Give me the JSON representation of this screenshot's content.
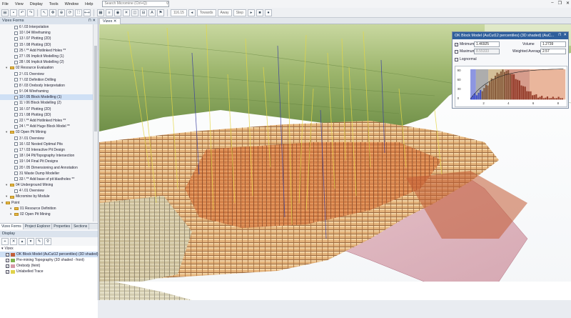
{
  "menu": {
    "items": [
      "File",
      "View",
      "Display",
      "Tools",
      "Window",
      "Help"
    ],
    "search_placeholder": "Search Micromine (Ctrl+Q)"
  },
  "toolbar": {
    "zoom_value": "116.15",
    "towards": "Towards",
    "away": "Away",
    "step": "Step"
  },
  "left_pane": {
    "title": "Vizex Forms",
    "tree": [
      {
        "label": "6 \\ 03 Interpolation",
        "indent": 3,
        "kind": "form"
      },
      {
        "label": "10 \\ 04 Wireframing",
        "indent": 3,
        "kind": "form"
      },
      {
        "label": "13 \\ 07 Plotting (2D)",
        "indent": 3,
        "kind": "form"
      },
      {
        "label": "15 \\ 08 Plotting (3D)",
        "indent": 3,
        "kind": "form"
      },
      {
        "label": "25 \\ ** Add Hotlinked Holes **",
        "indent": 3,
        "kind": "form"
      },
      {
        "label": "27 \\ 05 Implicit Modelling (1)",
        "indent": 3,
        "kind": "form"
      },
      {
        "label": "28 \\ 06 Implicit Modelling (2)",
        "indent": 3,
        "kind": "form"
      },
      {
        "label": "02 Resource Evaluation",
        "indent": 1,
        "kind": "folder"
      },
      {
        "label": "2 \\ 01 Overview",
        "indent": 3,
        "kind": "form"
      },
      {
        "label": "7 \\ 02 Definition Drilling",
        "indent": 3,
        "kind": "form"
      },
      {
        "label": "8 \\ 03 Orebody Interpretation",
        "indent": 3,
        "kind": "form"
      },
      {
        "label": "9 \\ 04 Wireframing",
        "indent": 3,
        "kind": "form"
      },
      {
        "label": "10 \\ 05 Block Modelling (1)",
        "indent": 3,
        "kind": "form",
        "selected": true
      },
      {
        "label": "11 \\ 06 Block Modelling (2)",
        "indent": 3,
        "kind": "form"
      },
      {
        "label": "16 \\ 07 Plotting (2D)",
        "indent": 3,
        "kind": "form"
      },
      {
        "label": "21 \\ 08 Plotting (3D)",
        "indent": 3,
        "kind": "form"
      },
      {
        "label": "22 \\ ** Add Hotlinked Holes **",
        "indent": 3,
        "kind": "form"
      },
      {
        "label": "24 \\ ** Add Huge Block Model **",
        "indent": 3,
        "kind": "form"
      },
      {
        "label": "03 Open Pit Mining",
        "indent": 1,
        "kind": "folder"
      },
      {
        "label": "3 \\ 01 Overview",
        "indent": 3,
        "kind": "form"
      },
      {
        "label": "16 \\ 02 Nested Optimal Pits",
        "indent": 3,
        "kind": "form"
      },
      {
        "label": "17 \\ 03 Interactive Pit Design",
        "indent": 3,
        "kind": "form"
      },
      {
        "label": "18 \\ 04 Pit/Topography Intersection",
        "indent": 3,
        "kind": "form"
      },
      {
        "label": "19 \\ 04 Final Pit Designs",
        "indent": 3,
        "kind": "form"
      },
      {
        "label": "20 \\ 05 Dimensioning and Annotation",
        "indent": 3,
        "kind": "form"
      },
      {
        "label": "31 Waste Dump Modeller",
        "indent": 3,
        "kind": "form"
      },
      {
        "label": "33 \\ ** Add base of pit blastholes **",
        "indent": 3,
        "kind": "form"
      },
      {
        "label": "04 Underground Mining",
        "indent": 1,
        "kind": "folder"
      },
      {
        "label": "4 \\ 01 Overview",
        "indent": 3,
        "kind": "form"
      },
      {
        "label": "Micromine by Module",
        "indent": 1,
        "kind": "folder"
      },
      {
        "label": "Point",
        "indent": 0,
        "kind": "folder"
      },
      {
        "label": "01 Resource Definition",
        "indent": 2,
        "kind": "folder"
      },
      {
        "label": "02 Open Pit Mining",
        "indent": 2,
        "kind": "folder"
      }
    ],
    "tabs": [
      "Vizex Forms",
      "Project Explorer",
      "Properties",
      "Sections"
    ],
    "display_title": "Display",
    "display_items": [
      {
        "label": "Vizex",
        "check": false,
        "swatch": "",
        "root": true
      },
      {
        "label": "OK Block Model (AuCut12 percentiles) (3D shaded)",
        "check": true,
        "swatch": "#c2603a",
        "selected": true
      },
      {
        "label": "Pre-mining Topography (3D shaded - front)",
        "check": true,
        "swatch": "#7fb34d"
      },
      {
        "label": "Orebody (feint)",
        "check": true,
        "swatch": "#d59aa8"
      },
      {
        "label": "Unlabelled Trace",
        "check": true,
        "swatch": "#e0d24a"
      }
    ]
  },
  "viewport": {
    "tab_label": "Vizex ✕"
  },
  "float_panel": {
    "title": "OK Block Model (AuCut12 percentiles) (3D shaded) (AuC...",
    "minimum_label": "Minimum",
    "minimum_value": "1.46925",
    "maximum_label": "Maximum",
    "maximum_value": "8.55333",
    "lognormal_label": "Lognormal",
    "volume_label": "Volume",
    "volume_value": "1.2739",
    "weighted_label": "Weighted Average",
    "weighted_value": "2.57",
    "hist_y_ticks": [
      "90",
      "60",
      "30",
      "0"
    ],
    "hist_x_ticks": [
      "2",
      "4",
      "6",
      "8"
    ]
  },
  "colors": {
    "title_blue": "#2f5f9c",
    "block_orange": "#d88a55",
    "topo_green": "#8aaa5a",
    "drill_yellow": "#e4d746"
  }
}
